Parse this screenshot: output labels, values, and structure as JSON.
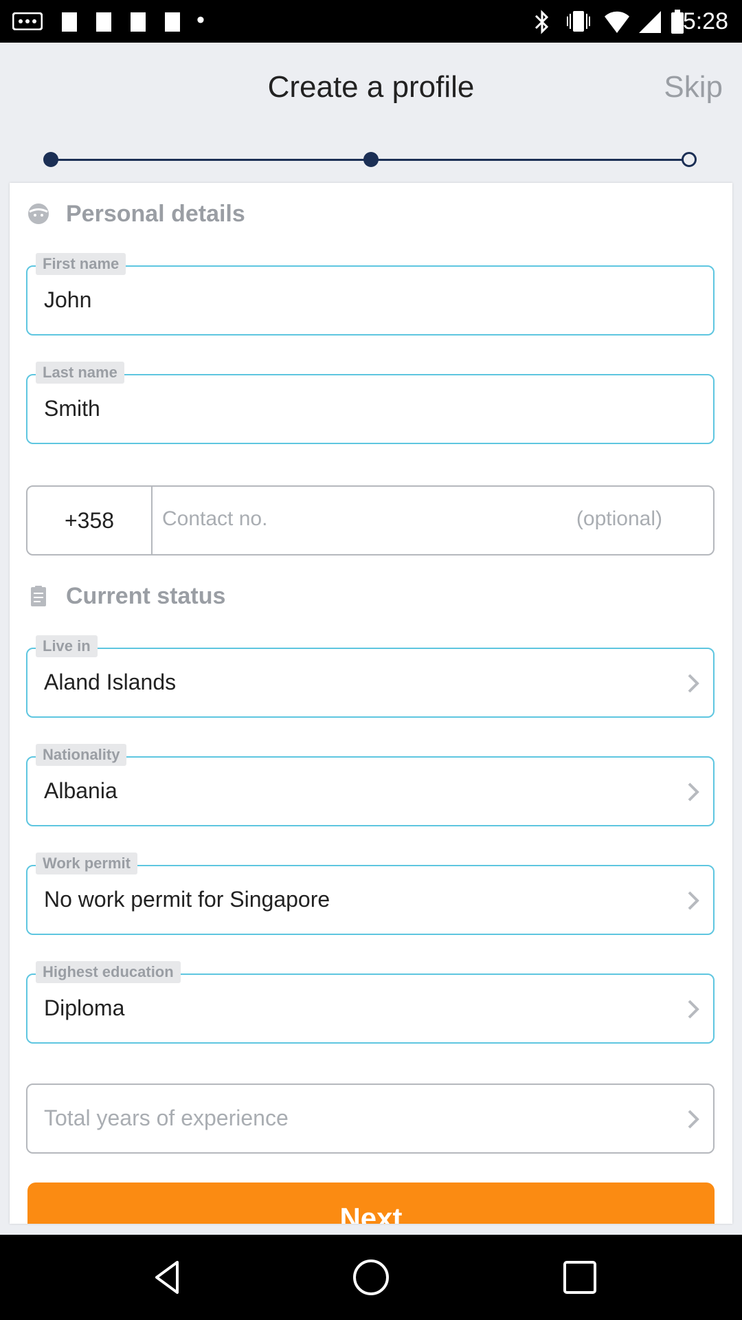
{
  "status_bar": {
    "time": "5:28"
  },
  "header": {
    "title": "Create a profile",
    "skip_label": "Skip"
  },
  "sections": {
    "personal": "Personal details",
    "status": "Current status"
  },
  "first_name": {
    "label": "First name",
    "value": "John"
  },
  "last_name": {
    "label": "Last name",
    "value": "Smith"
  },
  "phone": {
    "code": "+358",
    "placeholder": "Contact no.",
    "optional": "(optional)"
  },
  "live_in": {
    "label": "Live in",
    "value": "Aland Islands"
  },
  "nationality": {
    "label": "Nationality",
    "value": "Albania"
  },
  "work_permit": {
    "label": "Work permit",
    "value": "No work permit for Singapore"
  },
  "education": {
    "label": "Highest education",
    "value": "Diploma"
  },
  "experience": {
    "placeholder": "Total years of experience"
  },
  "next_label": "Next",
  "colors": {
    "accent": "#5ec6e0",
    "button": "#fb8b12",
    "stepper": "#1b2f55"
  }
}
